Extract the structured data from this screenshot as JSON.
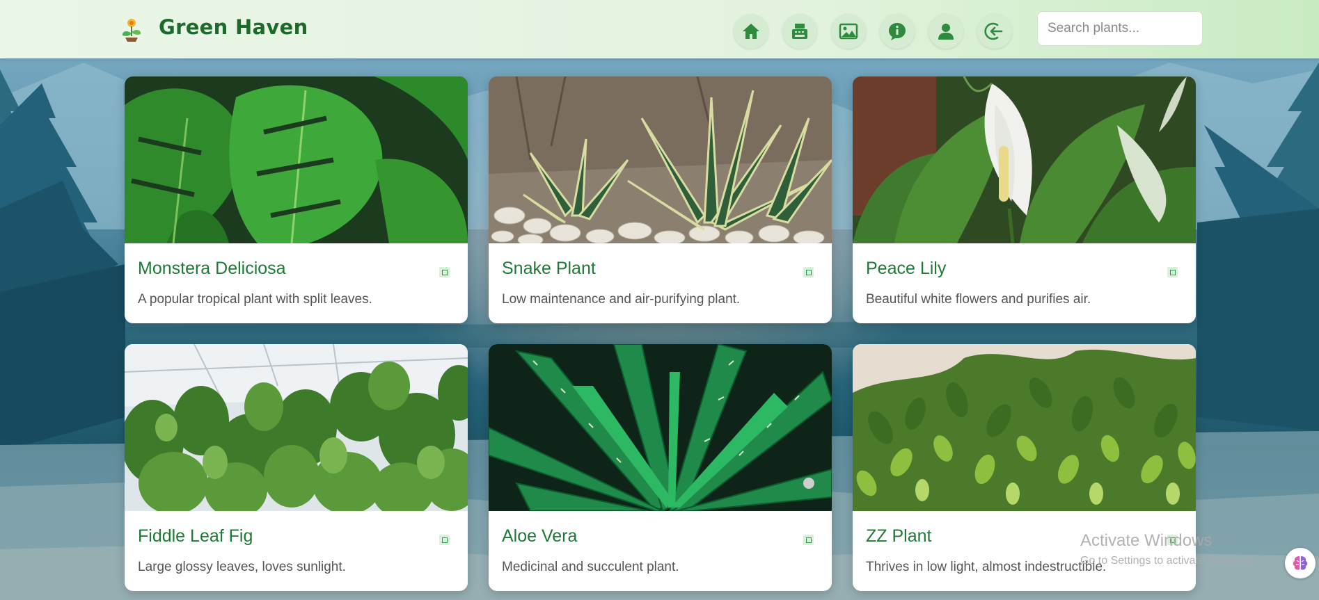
{
  "header": {
    "brand": "Green Haven",
    "logo_icon": "sprout-flower-icon",
    "nav": [
      {
        "name": "home",
        "icon": "home-icon"
      },
      {
        "name": "shop",
        "icon": "cash-register-icon"
      },
      {
        "name": "gallery",
        "icon": "image-icon"
      },
      {
        "name": "info",
        "icon": "info-chat-icon"
      },
      {
        "name": "profile",
        "icon": "user-icon"
      },
      {
        "name": "logout",
        "icon": "logout-icon"
      }
    ],
    "search": {
      "placeholder": "Search plants...",
      "value": ""
    }
  },
  "cards": [
    {
      "title": "Monstera Deliciosa",
      "description": "A popular tropical plant with split leaves.",
      "image": "monstera-leaves"
    },
    {
      "title": "Snake Plant",
      "description": "Low maintenance and air-purifying plant.",
      "image": "snake-plant"
    },
    {
      "title": "Peace Lily",
      "description": "Beautiful white flowers and purifies air.",
      "image": "peace-lily"
    },
    {
      "title": "Fiddle Leaf Fig",
      "description": "Large glossy leaves, loves sunlight.",
      "image": "fiddle-leaf-fig"
    },
    {
      "title": "Aloe Vera",
      "description": "Medicinal and succulent plant.",
      "image": "aloe-vera"
    },
    {
      "title": "ZZ Plant",
      "description": "Thrives in low light, almost indestructible.",
      "image": "zz-plant"
    }
  ],
  "watermark": {
    "title": "Activate Windows",
    "subtitle": "Go to Settings to activate Windows."
  },
  "colors": {
    "brand": "#1d6a2c",
    "nav_icon": "#2e8b3e",
    "card_title": "#1e7a36",
    "header_bg": "#e3f3df"
  }
}
